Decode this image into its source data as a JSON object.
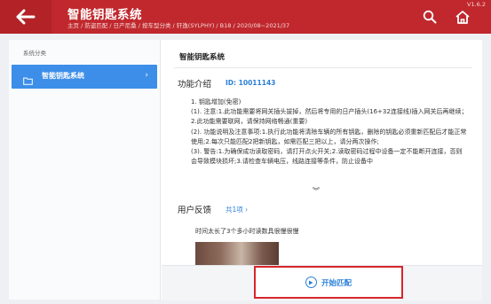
{
  "header": {
    "title": "智能钥匙系统",
    "breadcrumb": "主页 / 防盗匹配 / 日产尼桑 / 按车型分类 / 轩逸(SYLPHY) / B18 / 2020/08~2021/37",
    "version": "V1.6.2",
    "colors": {
      "bar": "#c0282d",
      "back": "#b22227"
    }
  },
  "icons": {
    "back": "arrow-left-icon",
    "search": "search-icon",
    "home": "home-icon"
  },
  "sidebar": {
    "heading": "系统分类",
    "items": [
      {
        "label": "智能钥匙系统",
        "selected": true
      }
    ]
  },
  "main": {
    "system_title": "智能钥匙系统",
    "function_intro_label": "功能介绍",
    "function_id": "ID: 10011143",
    "description": [
      "1. 钥匙增加(免密)",
      "(1). 注意:1.此功能需要将网关插头拔掉，然后将专用的日产插头(16+32连接线)插入网关后再继续；2.此功能需要联网，请保持网络畅通(重要)",
      "(2). 功能说明及注意事项:1.执行此功能将清除车辆的所有钥匙，删除的钥匙必须重新匹配后才能正常使用;2.每次只能匹配2把新钥匙，如需匹配三把以上，请分两次操作;",
      "(3). 警告:1.为确保成功读取密码，请打开点火开关;2.读取密码过程中设备一定不能断开连接，否则会导致模块损坏;3.请检查车辆电压，线路连接等条件，防止设备中"
    ],
    "expand_glyph": "︾",
    "feedback_label": "用户反馈",
    "feedback_count": "共1项 ›",
    "feedback_text": "时间太长了3个多小时读数具很慢很慢",
    "start_button": "开始匹配"
  }
}
